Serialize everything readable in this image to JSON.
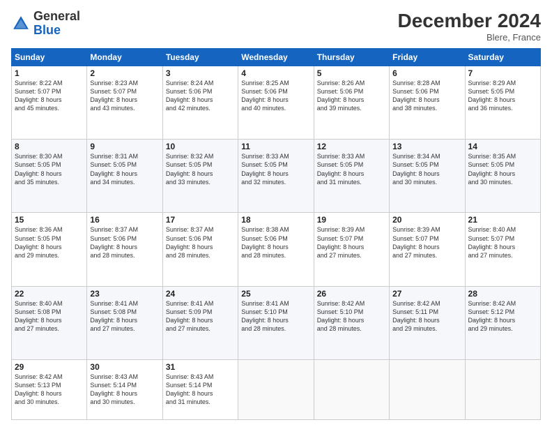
{
  "header": {
    "logo_general": "General",
    "logo_blue": "Blue",
    "month_year": "December 2024",
    "location": "Blere, France"
  },
  "days_of_week": [
    "Sunday",
    "Monday",
    "Tuesday",
    "Wednesday",
    "Thursday",
    "Friday",
    "Saturday"
  ],
  "weeks": [
    [
      {
        "day": "1",
        "lines": [
          "Sunrise: 8:22 AM",
          "Sunset: 5:07 PM",
          "Daylight: 8 hours",
          "and 45 minutes."
        ]
      },
      {
        "day": "2",
        "lines": [
          "Sunrise: 8:23 AM",
          "Sunset: 5:07 PM",
          "Daylight: 8 hours",
          "and 43 minutes."
        ]
      },
      {
        "day": "3",
        "lines": [
          "Sunrise: 8:24 AM",
          "Sunset: 5:06 PM",
          "Daylight: 8 hours",
          "and 42 minutes."
        ]
      },
      {
        "day": "4",
        "lines": [
          "Sunrise: 8:25 AM",
          "Sunset: 5:06 PM",
          "Daylight: 8 hours",
          "and 40 minutes."
        ]
      },
      {
        "day": "5",
        "lines": [
          "Sunrise: 8:26 AM",
          "Sunset: 5:06 PM",
          "Daylight: 8 hours",
          "and 39 minutes."
        ]
      },
      {
        "day": "6",
        "lines": [
          "Sunrise: 8:28 AM",
          "Sunset: 5:06 PM",
          "Daylight: 8 hours",
          "and 38 minutes."
        ]
      },
      {
        "day": "7",
        "lines": [
          "Sunrise: 8:29 AM",
          "Sunset: 5:05 PM",
          "Daylight: 8 hours",
          "and 36 minutes."
        ]
      }
    ],
    [
      {
        "day": "8",
        "lines": [
          "Sunrise: 8:30 AM",
          "Sunset: 5:05 PM",
          "Daylight: 8 hours",
          "and 35 minutes."
        ]
      },
      {
        "day": "9",
        "lines": [
          "Sunrise: 8:31 AM",
          "Sunset: 5:05 PM",
          "Daylight: 8 hours",
          "and 34 minutes."
        ]
      },
      {
        "day": "10",
        "lines": [
          "Sunrise: 8:32 AM",
          "Sunset: 5:05 PM",
          "Daylight: 8 hours",
          "and 33 minutes."
        ]
      },
      {
        "day": "11",
        "lines": [
          "Sunrise: 8:33 AM",
          "Sunset: 5:05 PM",
          "Daylight: 8 hours",
          "and 32 minutes."
        ]
      },
      {
        "day": "12",
        "lines": [
          "Sunrise: 8:33 AM",
          "Sunset: 5:05 PM",
          "Daylight: 8 hours",
          "and 31 minutes."
        ]
      },
      {
        "day": "13",
        "lines": [
          "Sunrise: 8:34 AM",
          "Sunset: 5:05 PM",
          "Daylight: 8 hours",
          "and 30 minutes."
        ]
      },
      {
        "day": "14",
        "lines": [
          "Sunrise: 8:35 AM",
          "Sunset: 5:05 PM",
          "Daylight: 8 hours",
          "and 30 minutes."
        ]
      }
    ],
    [
      {
        "day": "15",
        "lines": [
          "Sunrise: 8:36 AM",
          "Sunset: 5:05 PM",
          "Daylight: 8 hours",
          "and 29 minutes."
        ]
      },
      {
        "day": "16",
        "lines": [
          "Sunrise: 8:37 AM",
          "Sunset: 5:06 PM",
          "Daylight: 8 hours",
          "and 28 minutes."
        ]
      },
      {
        "day": "17",
        "lines": [
          "Sunrise: 8:37 AM",
          "Sunset: 5:06 PM",
          "Daylight: 8 hours",
          "and 28 minutes."
        ]
      },
      {
        "day": "18",
        "lines": [
          "Sunrise: 8:38 AM",
          "Sunset: 5:06 PM",
          "Daylight: 8 hours",
          "and 28 minutes."
        ]
      },
      {
        "day": "19",
        "lines": [
          "Sunrise: 8:39 AM",
          "Sunset: 5:07 PM",
          "Daylight: 8 hours",
          "and 27 minutes."
        ]
      },
      {
        "day": "20",
        "lines": [
          "Sunrise: 8:39 AM",
          "Sunset: 5:07 PM",
          "Daylight: 8 hours",
          "and 27 minutes."
        ]
      },
      {
        "day": "21",
        "lines": [
          "Sunrise: 8:40 AM",
          "Sunset: 5:07 PM",
          "Daylight: 8 hours",
          "and 27 minutes."
        ]
      }
    ],
    [
      {
        "day": "22",
        "lines": [
          "Sunrise: 8:40 AM",
          "Sunset: 5:08 PM",
          "Daylight: 8 hours",
          "and 27 minutes."
        ]
      },
      {
        "day": "23",
        "lines": [
          "Sunrise: 8:41 AM",
          "Sunset: 5:08 PM",
          "Daylight: 8 hours",
          "and 27 minutes."
        ]
      },
      {
        "day": "24",
        "lines": [
          "Sunrise: 8:41 AM",
          "Sunset: 5:09 PM",
          "Daylight: 8 hours",
          "and 27 minutes."
        ]
      },
      {
        "day": "25",
        "lines": [
          "Sunrise: 8:41 AM",
          "Sunset: 5:10 PM",
          "Daylight: 8 hours",
          "and 28 minutes."
        ]
      },
      {
        "day": "26",
        "lines": [
          "Sunrise: 8:42 AM",
          "Sunset: 5:10 PM",
          "Daylight: 8 hours",
          "and 28 minutes."
        ]
      },
      {
        "day": "27",
        "lines": [
          "Sunrise: 8:42 AM",
          "Sunset: 5:11 PM",
          "Daylight: 8 hours",
          "and 29 minutes."
        ]
      },
      {
        "day": "28",
        "lines": [
          "Sunrise: 8:42 AM",
          "Sunset: 5:12 PM",
          "Daylight: 8 hours",
          "and 29 minutes."
        ]
      }
    ],
    [
      {
        "day": "29",
        "lines": [
          "Sunrise: 8:42 AM",
          "Sunset: 5:13 PM",
          "Daylight: 8 hours",
          "and 30 minutes."
        ]
      },
      {
        "day": "30",
        "lines": [
          "Sunrise: 8:43 AM",
          "Sunset: 5:14 PM",
          "Daylight: 8 hours",
          "and 30 minutes."
        ]
      },
      {
        "day": "31",
        "lines": [
          "Sunrise: 8:43 AM",
          "Sunset: 5:14 PM",
          "Daylight: 8 hours",
          "and 31 minutes."
        ]
      },
      null,
      null,
      null,
      null
    ]
  ]
}
